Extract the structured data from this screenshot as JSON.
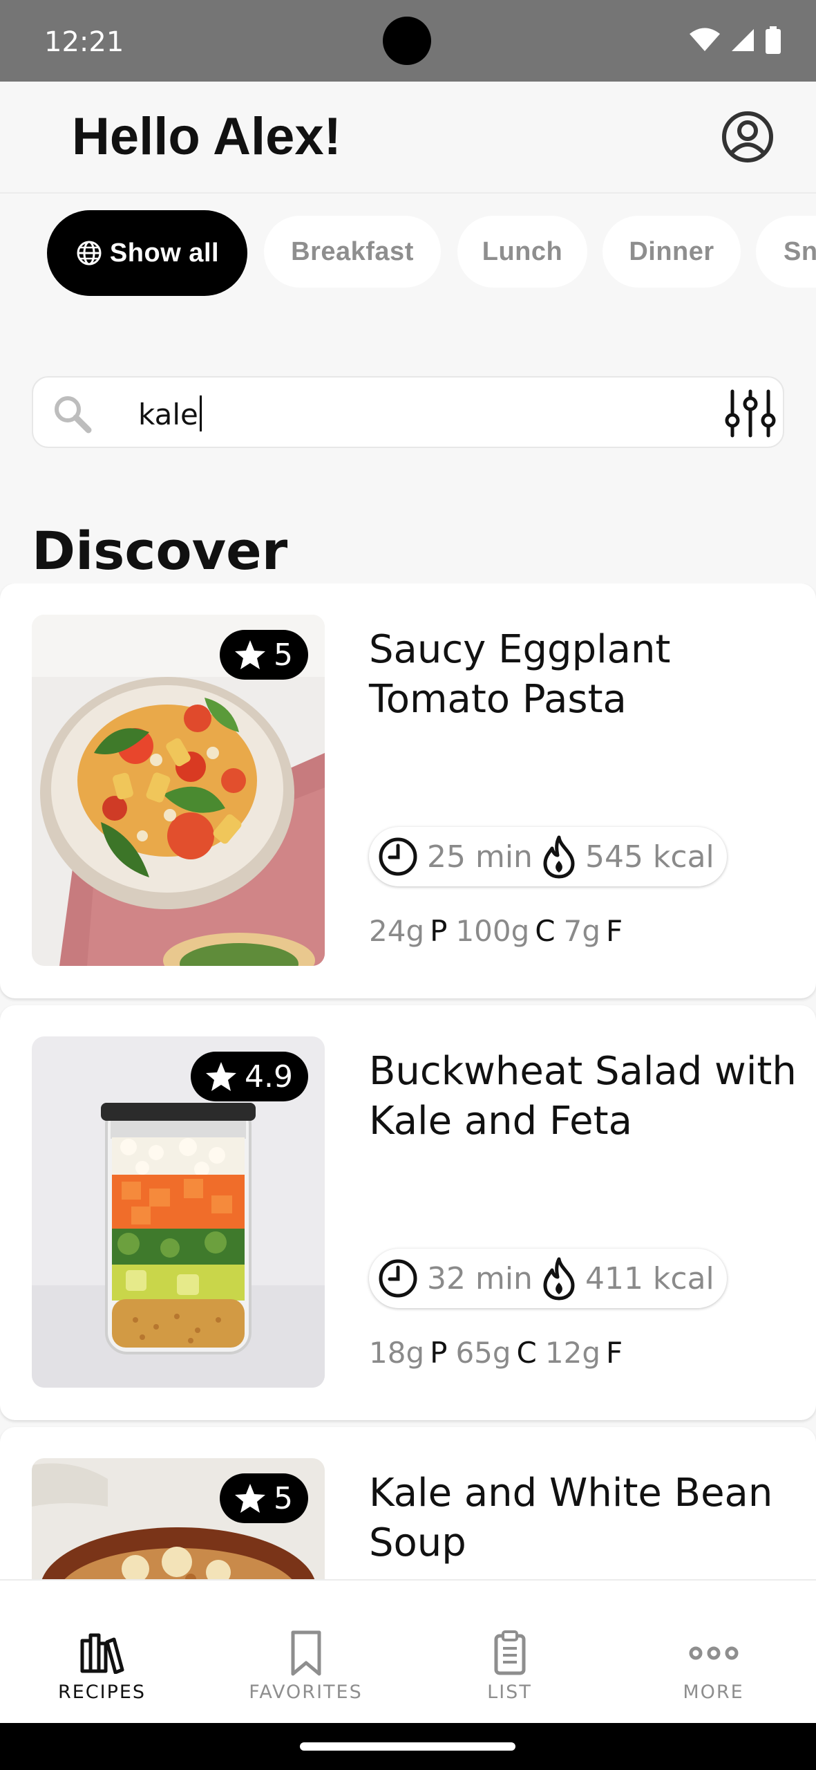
{
  "status_bar": {
    "time": "12:21"
  },
  "header": {
    "greeting": "Hello Alex!",
    "account_icon": "account-circle-icon"
  },
  "categories": [
    {
      "label": "Show all",
      "active": true,
      "icon": "globe-icon"
    },
    {
      "label": "Breakfast",
      "active": false
    },
    {
      "label": "Lunch",
      "active": false
    },
    {
      "label": "Dinner",
      "active": false
    },
    {
      "label": "Sna",
      "active": false
    }
  ],
  "search": {
    "value": "kale",
    "icon": "search-icon",
    "filter_icon": "filter-sliders-icon"
  },
  "section": {
    "title": "Discover"
  },
  "recipes": [
    {
      "rating": "5",
      "title": "Saucy Eggplant Tomato Pasta",
      "time": "25 min",
      "calories": "545 kcal",
      "protein": "24g",
      "carbs": "100g",
      "fat": "7g"
    },
    {
      "rating": "4.9",
      "title": "Buckwheat Salad with Kale and Feta",
      "time": "32 min",
      "calories": "411 kcal",
      "protein": "18g",
      "carbs": "65g",
      "fat": "12g"
    },
    {
      "rating": "5",
      "title": "Kale and White Bean Soup"
    }
  ],
  "macro_letters": {
    "protein": "P",
    "carbs": "C",
    "fat": "F"
  },
  "bottom_nav": [
    {
      "label": "RECIPES",
      "icon": "books-icon",
      "active": true
    },
    {
      "label": "FAVORITES",
      "icon": "bookmark-icon",
      "active": false
    },
    {
      "label": "LIST",
      "icon": "clipboard-list-icon",
      "active": false
    },
    {
      "label": "MORE",
      "icon": "more-dots-icon",
      "active": false
    }
  ],
  "colors": {
    "accent": "#000000",
    "muted_text": "#8e8e8e",
    "background": "#f7f7f7",
    "status_bar": "#757575"
  }
}
